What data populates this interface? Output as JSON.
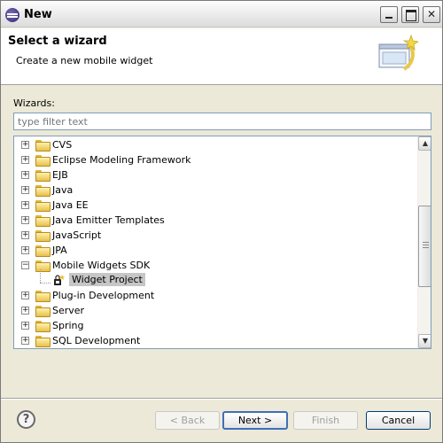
{
  "window": {
    "title": "New",
    "icon": "eclipse-icon",
    "controls": [
      "minimize-icon",
      "maximize-icon",
      "close-icon"
    ]
  },
  "banner": {
    "title": "Select a wizard",
    "subtitle": "Create a new mobile widget",
    "graphic": "wizard-sparkle-icon"
  },
  "wizards": {
    "label": "Wizards:",
    "filter_placeholder": "type filter text",
    "tree": [
      {
        "label": "CVS",
        "expander": "+",
        "icon": "folder-icon"
      },
      {
        "label": "Eclipse Modeling Framework",
        "expander": "+",
        "icon": "folder-icon"
      },
      {
        "label": "EJB",
        "expander": "+",
        "icon": "folder-icon"
      },
      {
        "label": "Java",
        "expander": "+",
        "icon": "folder-icon"
      },
      {
        "label": "Java EE",
        "expander": "+",
        "icon": "folder-icon"
      },
      {
        "label": "Java Emitter Templates",
        "expander": "+",
        "icon": "folder-icon"
      },
      {
        "label": "JavaScript",
        "expander": "+",
        "icon": "folder-icon"
      },
      {
        "label": "JPA",
        "expander": "+",
        "icon": "folder-icon"
      },
      {
        "label": "Mobile Widgets SDK",
        "expander": "−",
        "icon": "folder-icon"
      },
      {
        "label": "Widget Project",
        "child": true,
        "selected": true,
        "icon": "widget-project-icon"
      },
      {
        "label": "Plug-in Development",
        "expander": "+",
        "icon": "folder-icon"
      },
      {
        "label": "Server",
        "expander": "+",
        "icon": "folder-icon"
      },
      {
        "label": "Spring",
        "expander": "+",
        "icon": "folder-icon"
      },
      {
        "label": "SQL Development",
        "expander": "+",
        "icon": "folder-icon"
      }
    ]
  },
  "buttons": {
    "help_icon": "help-icon",
    "help_glyph": "?",
    "back": "< Back",
    "next": "Next >",
    "finish": "Finish",
    "cancel": "Cancel"
  },
  "colors": {
    "dialog_bg": "#ece9d8",
    "selection_bg": "#c6c6c6",
    "input_border": "#7f9db9"
  }
}
